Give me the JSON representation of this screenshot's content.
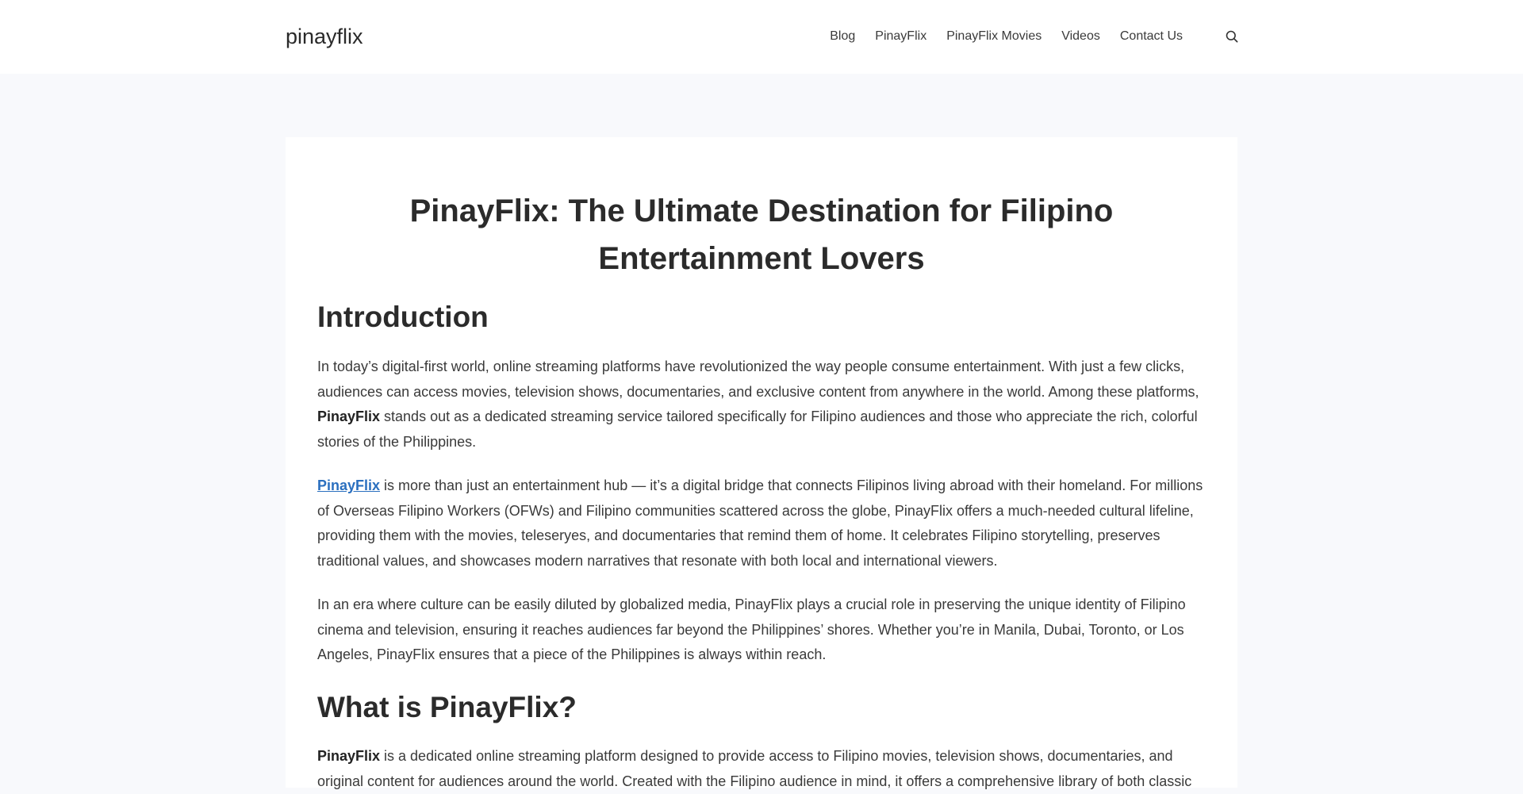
{
  "site": {
    "title": "pinayflix"
  },
  "nav": {
    "items": [
      "Blog",
      "PinayFlix",
      "PinayFlix Movies",
      "Videos",
      "Contact Us"
    ]
  },
  "post": {
    "title": "PinayFlix: The Ultimate Destination for Filipino Entertainment Lovers",
    "sections": [
      {
        "heading": "Introduction"
      },
      {
        "heading": "What is PinayFlix?"
      }
    ],
    "p1": {
      "before": "In today’s digital-first world, online streaming platforms have revolutionized the way people consume entertainment. With just a few clicks, audiences can access movies, television shows, documentaries, and exclusive content from anywhere in the world. Among these platforms, ",
      "bold": "PinayFlix",
      "after": " stands out as a dedicated streaming service tailored specifically for Filipino audiences and those who appreciate the rich, colorful stories of the Philippines."
    },
    "p2": {
      "link": "PinayFlix",
      "after": " is more than just an entertainment hub — it’s a digital bridge that connects Filipinos living abroad with their homeland. For millions of Overseas Filipino Workers (OFWs) and Filipino communities scattered across the globe, PinayFlix offers a much-needed cultural lifeline, providing them with the movies, teleseryes, and documentaries that remind them of home. It celebrates Filipino storytelling, preserves traditional values, and showcases modern narratives that resonate with both local and international viewers."
    },
    "p3": {
      "text": "In an era where culture can be easily diluted by globalized media, PinayFlix plays a crucial role in preserving the unique identity of Filipino cinema and television, ensuring it reaches audiences far beyond the Philippines’ shores. Whether you’re in Manila, Dubai, Toronto, or Los Angeles, PinayFlix ensures that a piece of the Philippines is always within reach."
    },
    "p4": {
      "bold": "PinayFlix",
      "after": " is a dedicated online streaming platform designed to provide access to Filipino movies, television shows, documentaries, and original content for audiences around the world. Created with the Filipino audience in mind, it offers a comprehensive library of both classic"
    }
  },
  "colors": {
    "page_background": "#f8f9fc",
    "link": "#2a6fbf",
    "text": "#3a3a3a"
  },
  "icons": {
    "search": "search-icon"
  }
}
